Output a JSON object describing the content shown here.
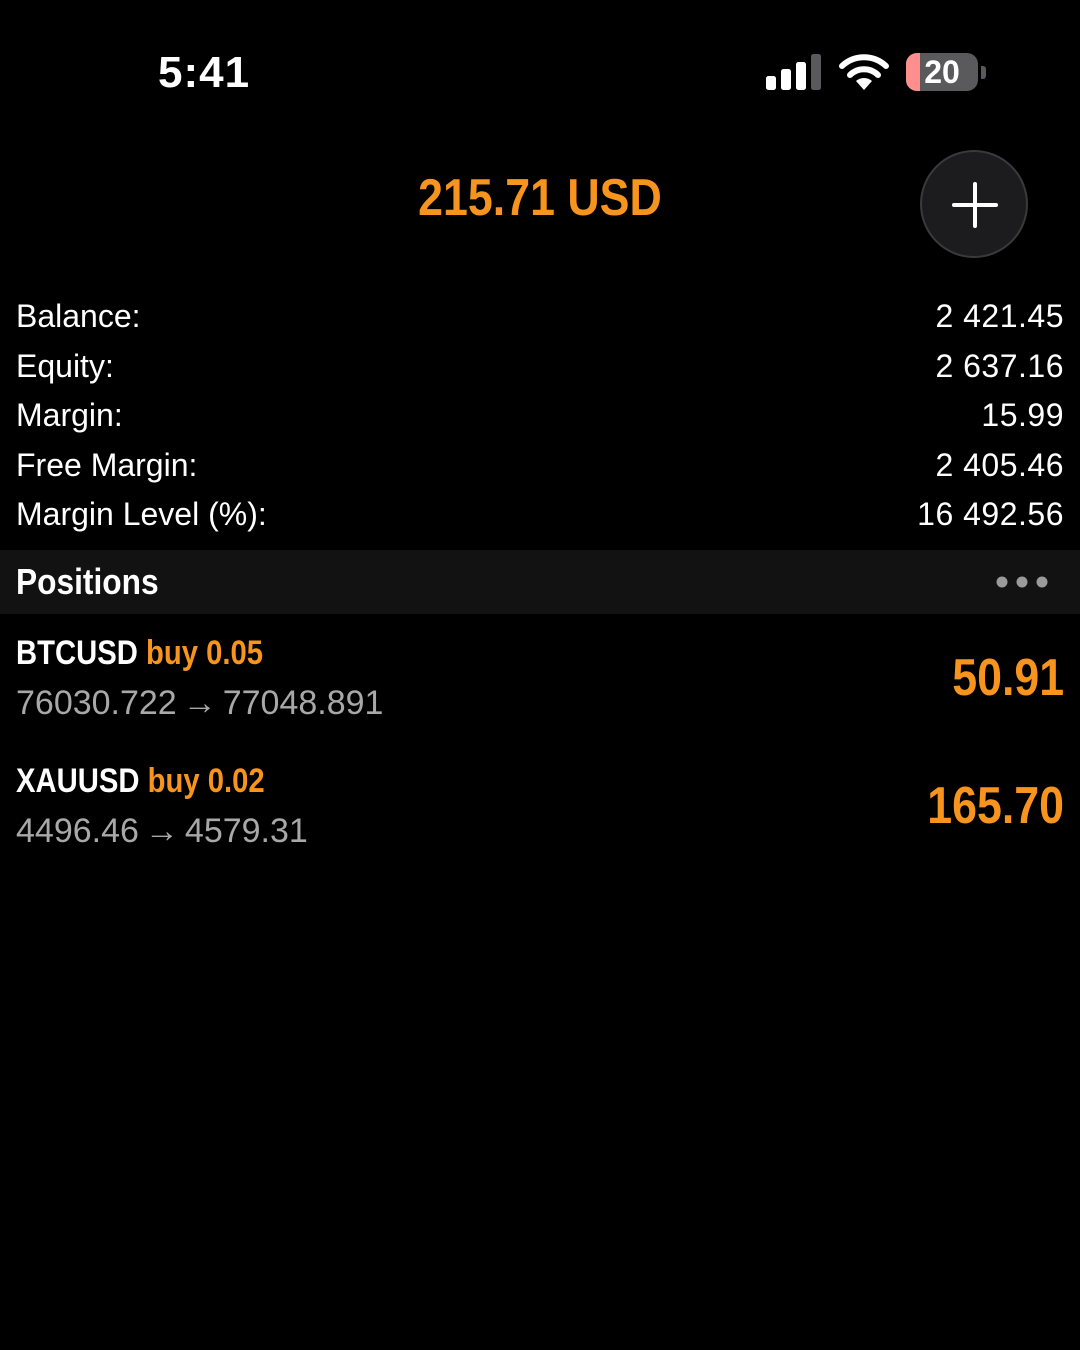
{
  "status_bar": {
    "time": "5:41",
    "battery_level": "20",
    "battery_fraction": 0.2,
    "icons": [
      "signal-icon",
      "wifi-icon",
      "battery-icon"
    ]
  },
  "header": {
    "total_profit": "215.71 USD",
    "add_icon": "plus-icon"
  },
  "summary": [
    {
      "label": "Balance:",
      "value": "2 421.45"
    },
    {
      "label": "Equity:",
      "value": "2 637.16"
    },
    {
      "label": "Margin:",
      "value": "15.99"
    },
    {
      "label": "Free Margin:",
      "value": "2 405.46"
    },
    {
      "label": "Margin Level (%):",
      "value": "16 492.56"
    }
  ],
  "positions": {
    "title": "Positions",
    "more_icon": "more-horizontal-icon",
    "arrow": "→",
    "items": [
      {
        "symbol": "BTCUSD",
        "side": "buy",
        "volume": "0.05",
        "open_price": "76030.722",
        "current_price": "77048.891",
        "profit": "50.91"
      },
      {
        "symbol": "XAUUSD",
        "side": "buy",
        "volume": "0.02",
        "open_price": "4496.46",
        "current_price": "4579.31",
        "profit": "165.70"
      }
    ]
  },
  "colors": {
    "accent": "#f7941d",
    "background": "#000000",
    "secondary_text": "#a8a8a8",
    "section_bg": "#121212"
  }
}
